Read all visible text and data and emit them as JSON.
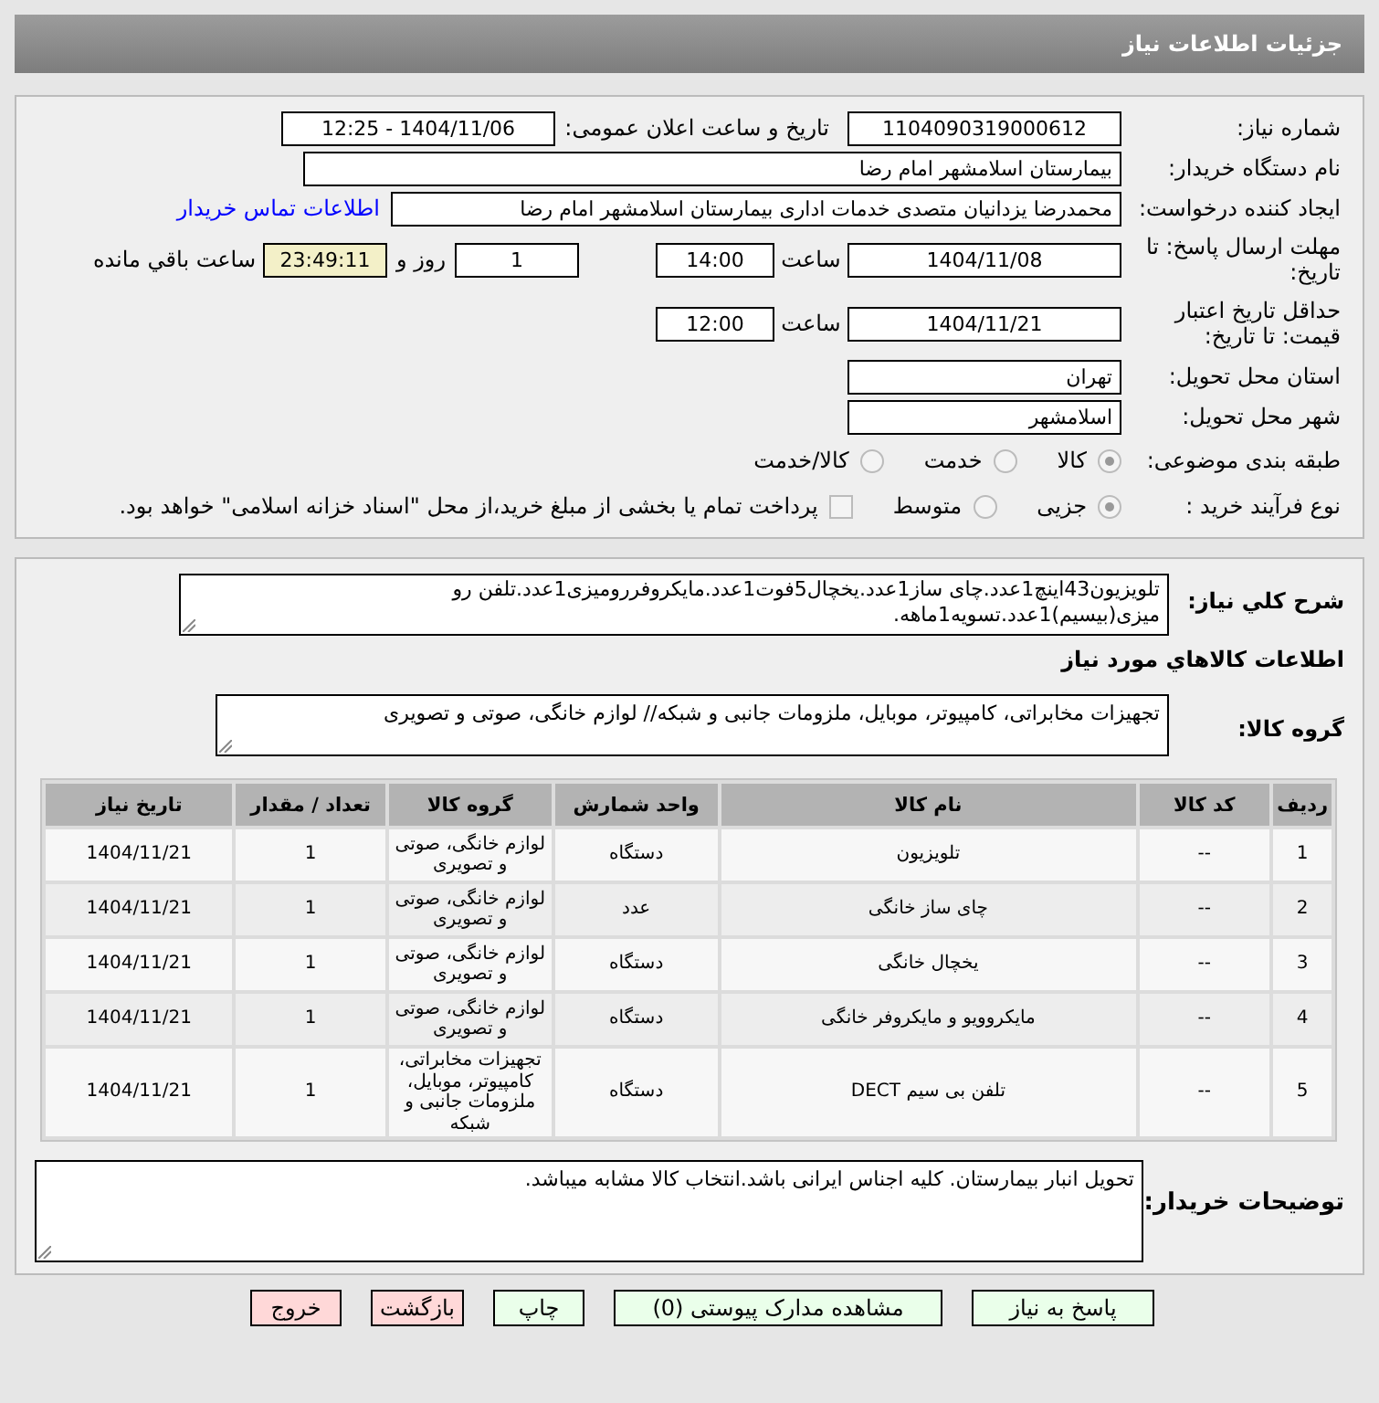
{
  "header": {
    "title": "جزئیات اطلاعات نیاز"
  },
  "need_number": {
    "label": "شماره نیاز:",
    "value": "1104090319000612"
  },
  "announce": {
    "label": "تاریخ و ساعت اعلان عمومی:",
    "value": "1404/11/06 - 12:25"
  },
  "buyer": {
    "label": "نام دستگاه خریدار:",
    "value": "بیمارستان اسلامشهر   امام رضا"
  },
  "creator": {
    "label": "ایجاد کننده درخواست:",
    "value": "محمدرضا یزدانیان متصدی خدمات اداری بیمارستان اسلامشهر   امام رضا",
    "link": "اطلاعات تماس خریدار"
  },
  "deadline": {
    "label": "مهلت ارسال پاسخ: تا تاریخ:",
    "date": "1404/11/08",
    "time_label": "ساعت",
    "time": "14:00",
    "days": "1",
    "days_label": "روز و",
    "remaining": "23:49:11",
    "remaining_label": "ساعت باقي مانده"
  },
  "validity": {
    "label": "حداقل تاریخ اعتبار قیمت: تا تاریخ:",
    "date": "1404/11/21",
    "time_label": "ساعت",
    "time": "12:00"
  },
  "province": {
    "label": "استان محل تحویل:",
    "value": "تهران"
  },
  "city": {
    "label": "شهر محل تحویل:",
    "value": "اسلامشهر"
  },
  "classification": {
    "label": "طبقه بندی موضوعی:",
    "options": [
      {
        "label": "کالا",
        "selected": true
      },
      {
        "label": "خدمت",
        "selected": false
      },
      {
        "label": "کالا/خدمت",
        "selected": false
      }
    ]
  },
  "purchase_type": {
    "label": "نوع فرآیند خرید :",
    "options": [
      {
        "label": "جزیی",
        "selected": true
      },
      {
        "label": "متوسط",
        "selected": false
      }
    ],
    "treasury": {
      "label": "پرداخت تمام یا بخشی از مبلغ خرید،از محل \"اسناد خزانه اسلامی\" خواهد بود.",
      "checked": false
    }
  },
  "description": {
    "label": "شرح کلي نياز:",
    "value": "تلویزیون43اینچ1عدد.چای ساز1عدد.یخچال5فوت1عدد.مایکروفررومیزی1عدد.تلفن رو میزی(بیسیم)1عدد.تسویه1ماهه."
  },
  "items_title": "اطلاعات کالاهاي مورد نياز",
  "goods_group": {
    "label": "گروه کالا:",
    "value": "تجهیزات مخابراتی، کامپیوتر، موبایل، ملزومات جانبی و شبکه// لوازم خانگی، صوتی و تصویری"
  },
  "table": {
    "columns": [
      "ردیف",
      "کد کالا",
      "نام کالا",
      "واحد شمارش",
      "گروه کالا",
      "تعداد / مقدار",
      "تاریخ نیاز"
    ],
    "rows": [
      [
        "1",
        "--",
        "تلویزیون",
        "دستگاه",
        "لوازم خانگی، صوتی و تصویری",
        "1",
        "1404/11/21"
      ],
      [
        "2",
        "--",
        "چای ساز خانگی",
        "عدد",
        "لوازم خانگی، صوتی و تصویری",
        "1",
        "1404/11/21"
      ],
      [
        "3",
        "--",
        "یخچال خانگی",
        "دستگاه",
        "لوازم خانگی، صوتی و تصویری",
        "1",
        "1404/11/21"
      ],
      [
        "4",
        "--",
        "مایکروویو و مایکروفر خانگی",
        "دستگاه",
        "لوازم خانگی، صوتی و تصویری",
        "1",
        "1404/11/21"
      ],
      [
        "5",
        "--",
        "تلفن بی سیم DECT",
        "دستگاه",
        "تجهیزات مخابراتی، کامپیوتر، موبایل، ملزومات جانبی و شبکه",
        "1",
        "1404/11/21"
      ]
    ]
  },
  "notes": {
    "label": "توضیحات خریدار:",
    "value": "تحویل انبار بیمارستان. کلیه اجناس ایرانی باشد.انتخاب کالا مشابه میباشد."
  },
  "buttons": [
    {
      "label": "پاسخ به نیاز",
      "kind": "action"
    },
    {
      "label": "مشاهده مدارک پیوستی (0)",
      "kind": "action"
    },
    {
      "label": "چاپ",
      "kind": "action"
    },
    {
      "label": "بازگشت",
      "kind": "danger"
    },
    {
      "label": "خروج",
      "kind": "danger"
    }
  ]
}
